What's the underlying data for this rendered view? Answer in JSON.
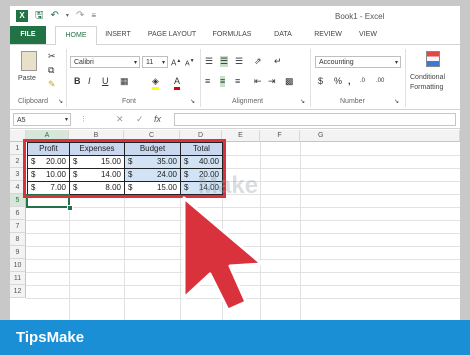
{
  "window": {
    "title": "Book1 - Excel"
  },
  "ribbon_tabs": [
    "FILE",
    "HOME",
    "INSERT",
    "PAGE LAYOUT",
    "FORMULAS",
    "DATA",
    "REVIEW",
    "VIEW"
  ],
  "ribbon": {
    "clipboard_label": "Clipboard",
    "paste_label": "Paste",
    "font_label": "Font",
    "font_name": "Calibri",
    "font_size": "11",
    "alignment_label": "Alignment",
    "number_label": "Number",
    "number_format": "Accounting",
    "conditional_label": "Conditional",
    "formatting_label": "Formatting",
    "bold": "B",
    "italic": "I",
    "underline": "U",
    "dollar": "$",
    "percent": "%",
    "comma": ","
  },
  "formula_bar": {
    "name_box": "A5",
    "fx": "fx"
  },
  "columns": [
    "A",
    "B",
    "C",
    "D",
    "E",
    "F",
    "G"
  ],
  "rows": [
    "1",
    "2",
    "3",
    "4",
    "5",
    "6",
    "7",
    "8",
    "9",
    "10",
    "11",
    "12"
  ],
  "table": {
    "headers": [
      "Profit",
      "Expenses",
      "Budget",
      "Total"
    ],
    "rows": [
      [
        "20.00",
        "15.00",
        "35.00",
        "40.00"
      ],
      [
        "10.00",
        "14.00",
        "24.00",
        "20.00"
      ],
      [
        "7.00",
        "8.00",
        "15.00",
        "14.00"
      ]
    ],
    "currency": "$"
  },
  "watermark": "Make",
  "brand": "TipsMake",
  "colors": {
    "excel_green": "#217346",
    "header_fill": "#c9d8ef",
    "highlight_red": "#d9323c",
    "banner_blue": "#1a8fd6"
  }
}
